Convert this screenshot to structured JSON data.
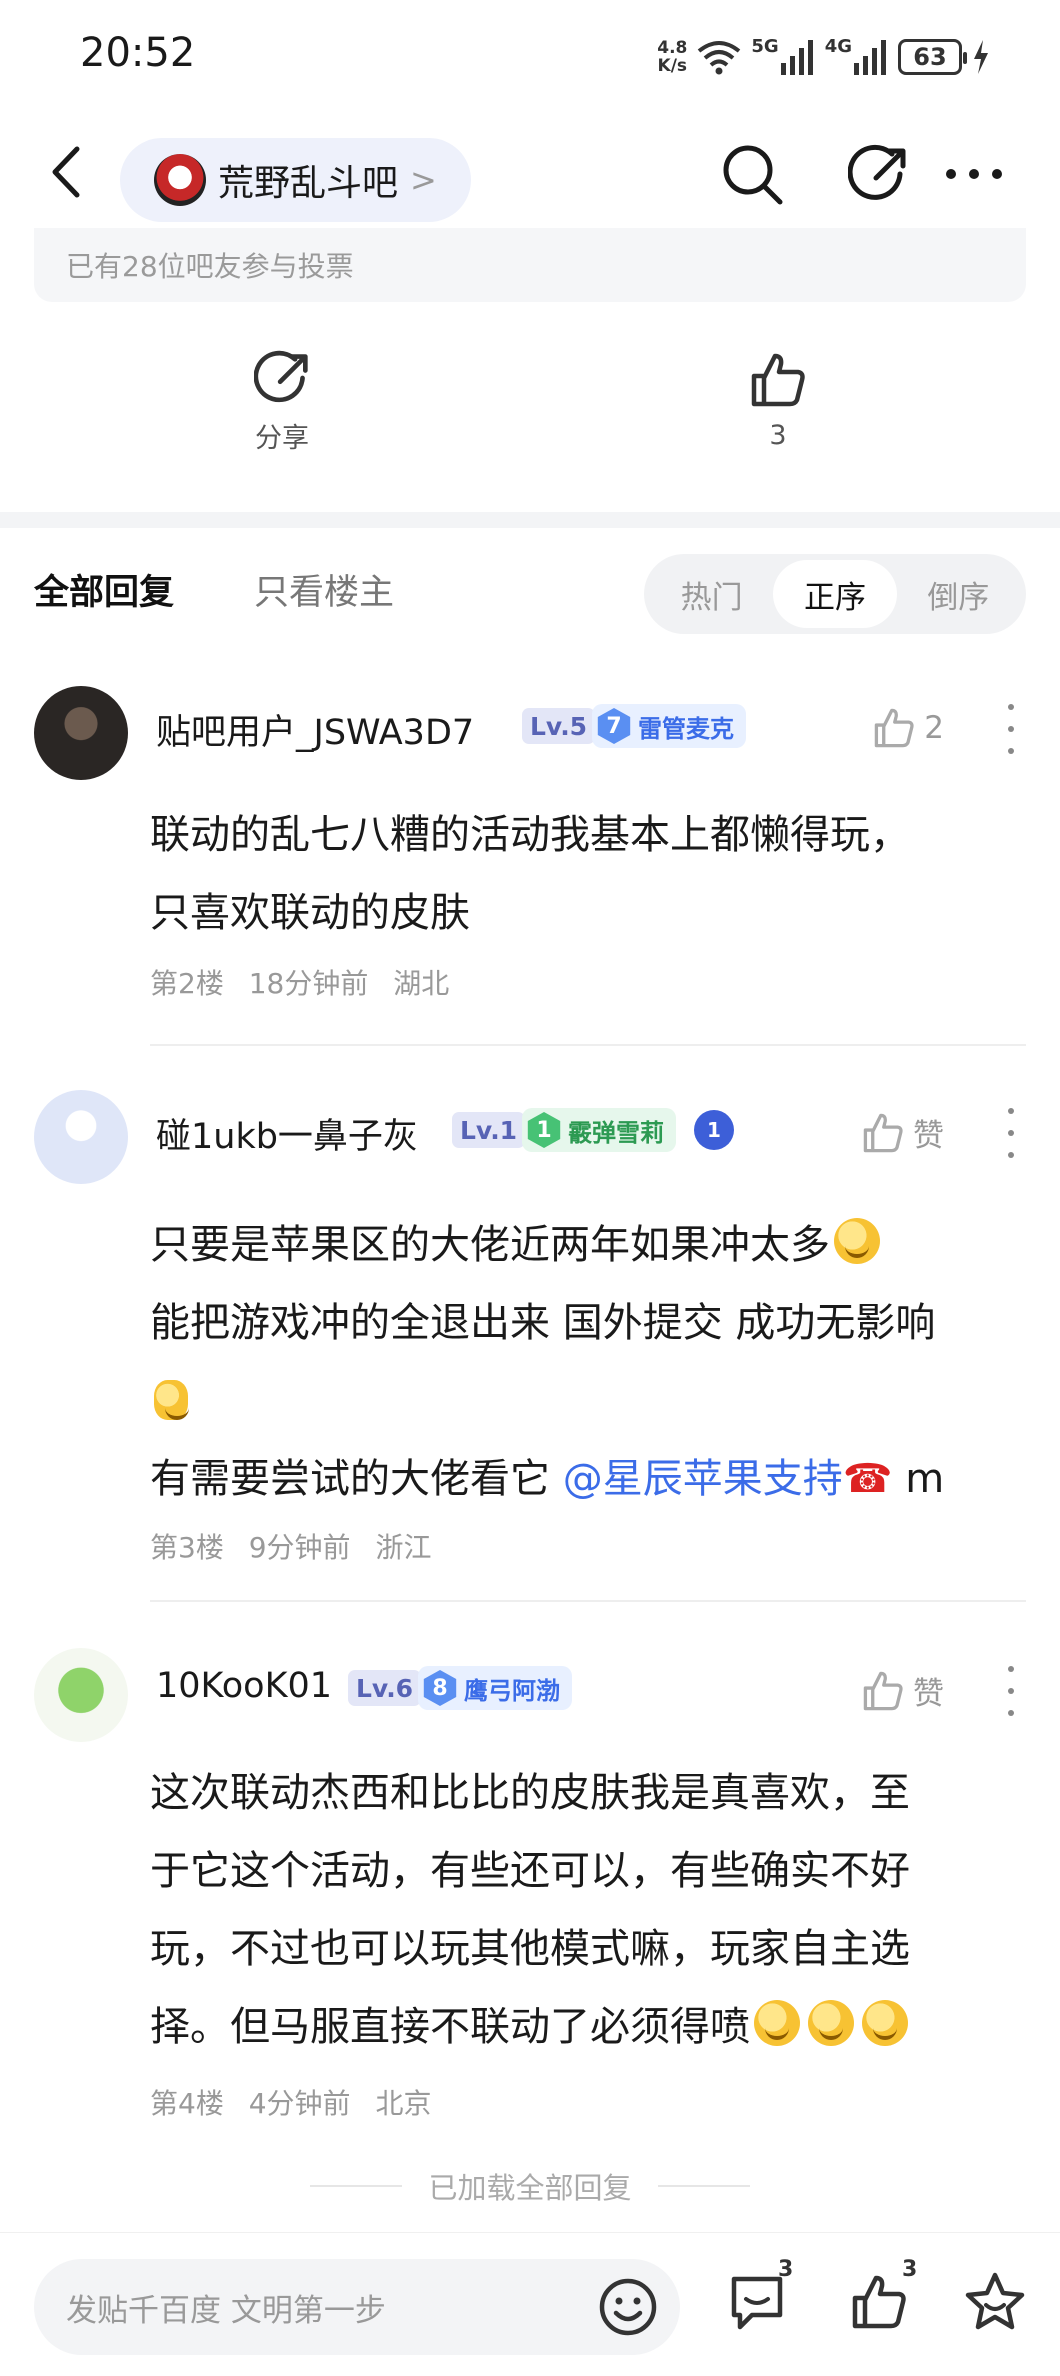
{
  "status_bar": {
    "time": "20:52",
    "net_speed_value": "4.8",
    "net_speed_unit": "K/s",
    "signal_1": "5G",
    "signal_2": "4G",
    "battery": "63"
  },
  "nav": {
    "forum_name": "荒野乱斗吧",
    "forum_chevron": ">"
  },
  "vote": {
    "participants_text": "已有28位吧友参与投票"
  },
  "actions": {
    "share_label": "分享",
    "like_count": "3"
  },
  "filter": {
    "tabs": [
      "全部回复",
      "只看楼主"
    ],
    "sort_options": [
      "热门",
      "正序",
      "倒序"
    ],
    "selected_sort": "正序"
  },
  "replies": [
    {
      "username": "贴吧用户_JSWA3D7",
      "level": "Lv.5",
      "badge_num": "7",
      "badge_name": "雷管麦克",
      "likes": "2",
      "lines": [
        "联动的乱七八糟的活动我基本上都懒得玩，",
        "只喜欢联动的皮肤"
      ],
      "floor": "第2楼",
      "time": "18分钟前",
      "location": "湖北"
    },
    {
      "username": "碰1ukb一鼻子灰",
      "level": "Lv.1",
      "badge_num": "1",
      "badge_name": "霰弹雪莉",
      "extra_badge": "1",
      "likes": "赞",
      "line1": "只要是苹果区的大佬近两年如果冲太多",
      "line2": "能把游戏冲的全退出来 国外提交 成功无影响",
      "line3_prefix": "有需要尝试的大佬看它 ",
      "line3_mention": "@星辰苹果支持",
      "line3_suffix": " m",
      "floor": "第3楼",
      "time": "9分钟前",
      "location": "浙江"
    },
    {
      "username": "10KooK01",
      "level": "Lv.6",
      "badge_num": "8",
      "badge_name": "鹰弓阿渤",
      "likes": "赞",
      "lines": [
        "这次联动杰西和比比的皮肤我是真喜欢，至",
        "于它这个活动，有些还可以，有些确实不好",
        "玩，不过也可以玩其他模式嘛，玩家自主选"
      ],
      "last_line": "择。但马服直接不联动了必须得喷",
      "floor": "第4楼",
      "time": "4分钟前",
      "location": "北京"
    }
  ],
  "footer": {
    "loaded_all": "已加载全部回复"
  },
  "bottom_bar": {
    "compose_placeholder": "发贴千百度 文明第一步",
    "comment_count": "3",
    "like_count": "3"
  },
  "colors": {
    "accent_blue": "#3b6ce8",
    "level_bg": "#e3e6f7",
    "chip_bg": "#eef1fb"
  }
}
